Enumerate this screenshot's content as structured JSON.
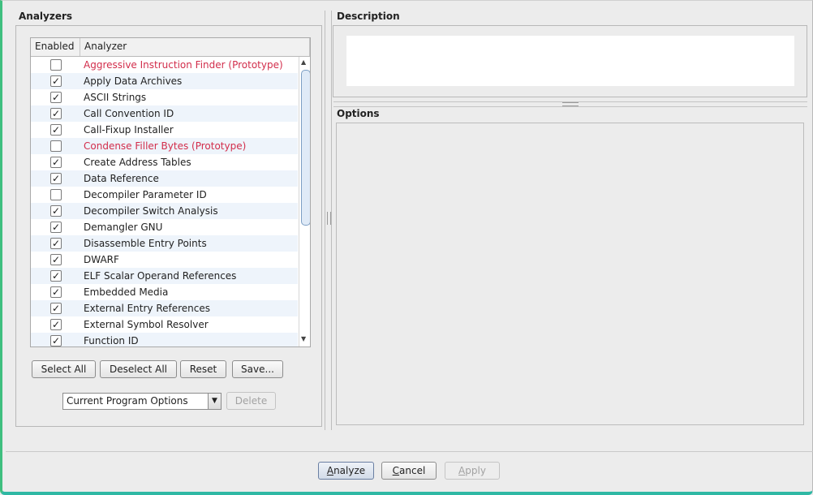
{
  "analyzers": {
    "title": "Analyzers",
    "columns": {
      "enabled": "Enabled",
      "analyzer": "Analyzer"
    },
    "rows": [
      {
        "name": "Aggressive Instruction Finder (Prototype)",
        "checked": false,
        "prototype": true
      },
      {
        "name": "Apply Data Archives",
        "checked": true,
        "prototype": false
      },
      {
        "name": "ASCII Strings",
        "checked": true,
        "prototype": false
      },
      {
        "name": "Call Convention ID",
        "checked": true,
        "prototype": false
      },
      {
        "name": "Call-Fixup Installer",
        "checked": true,
        "prototype": false
      },
      {
        "name": "Condense Filler Bytes (Prototype)",
        "checked": false,
        "prototype": true
      },
      {
        "name": "Create Address Tables",
        "checked": true,
        "prototype": false
      },
      {
        "name": "Data Reference",
        "checked": true,
        "prototype": false
      },
      {
        "name": "Decompiler Parameter ID",
        "checked": false,
        "prototype": false
      },
      {
        "name": "Decompiler Switch Analysis",
        "checked": true,
        "prototype": false
      },
      {
        "name": "Demangler GNU",
        "checked": true,
        "prototype": false
      },
      {
        "name": "Disassemble Entry Points",
        "checked": true,
        "prototype": false
      },
      {
        "name": "DWARF",
        "checked": true,
        "prototype": false
      },
      {
        "name": "ELF Scalar Operand References",
        "checked": true,
        "prototype": false
      },
      {
        "name": "Embedded Media",
        "checked": true,
        "prototype": false
      },
      {
        "name": "External Entry References",
        "checked": true,
        "prototype": false
      },
      {
        "name": "External Symbol Resolver",
        "checked": true,
        "prototype": false
      },
      {
        "name": "Function ID",
        "checked": true,
        "prototype": false
      }
    ],
    "buttons": {
      "select_all": "Select All",
      "deselect_all": "Deselect All",
      "reset": "Reset",
      "save": "Save..."
    },
    "options_combo": {
      "value": "Current Program Options"
    },
    "delete_label": "Delete"
  },
  "description": {
    "title": "Description",
    "text": ""
  },
  "options": {
    "title": "Options"
  },
  "footer": {
    "analyze_mnemonic": "A",
    "analyze_rest": "nalyze",
    "cancel_mnemonic": "C",
    "cancel_rest": "ancel",
    "apply_mnemonic": "A",
    "apply_rest": "pply"
  },
  "colors": {
    "prototype_text": "#d22d4b",
    "accent_border": "#3fbf7f"
  }
}
